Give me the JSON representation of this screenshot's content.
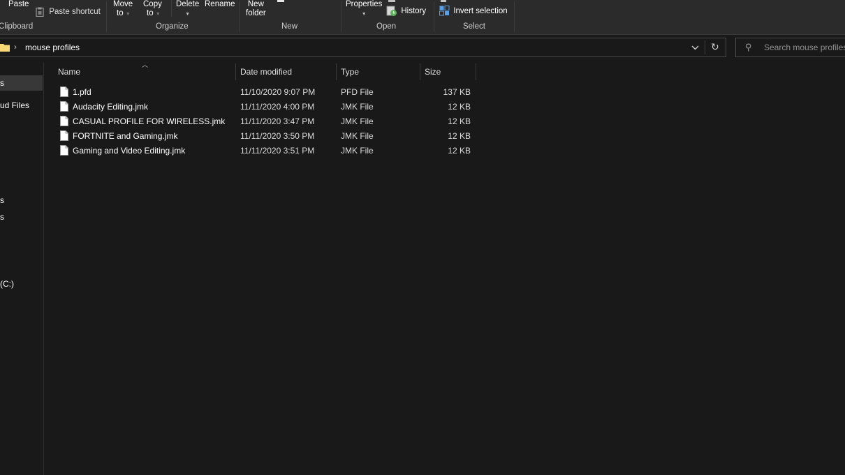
{
  "ribbon": {
    "clipboard": {
      "paste_label": "Paste",
      "paste_shortcut_label": "Paste shortcut",
      "group_label": "Clipboard"
    },
    "organize": {
      "move_to_line1": "Move",
      "move_to_line2": "to",
      "copy_to_line1": "Copy",
      "copy_to_line2": "to",
      "delete_label": "Delete",
      "rename_label": "Rename",
      "group_label": "Organize"
    },
    "new": {
      "new_folder_line1": "New",
      "new_folder_line2": "folder",
      "group_label": "New"
    },
    "open": {
      "properties_label": "Properties",
      "history_label": "History",
      "group_label": "Open"
    },
    "select": {
      "invert_selection_label": "Invert selection",
      "group_label": "Select"
    }
  },
  "address": {
    "current_folder": "mouse profiles",
    "search_placeholder": "Search mouse profiles"
  },
  "nav": {
    "items": [
      {
        "label": "s"
      },
      {
        "label": "ud Files"
      },
      {
        "label": "s"
      },
      {
        "label": "s"
      },
      {
        "label": "(C:)"
      }
    ]
  },
  "columns": {
    "name": "Name",
    "date_modified": "Date modified",
    "type": "Type",
    "size": "Size"
  },
  "files": [
    {
      "name": "1.pfd",
      "date": "11/10/2020 9:07 PM",
      "type": "PFD File",
      "size": "137 KB"
    },
    {
      "name": "Audacity Editing.jmk",
      "date": "11/11/2020 4:00 PM",
      "type": "JMK File",
      "size": "12 KB"
    },
    {
      "name": "CASUAL PROFILE FOR WIRELESS.jmk",
      "date": "11/11/2020 3:47 PM",
      "type": "JMK File",
      "size": "12 KB"
    },
    {
      "name": "FORTNITE and Gaming.jmk",
      "date": "11/11/2020 3:50 PM",
      "type": "JMK File",
      "size": "12 KB"
    },
    {
      "name": "Gaming and Video Editing.jmk",
      "date": "11/11/2020 3:51 PM",
      "type": "JMK File",
      "size": "12 KB"
    }
  ],
  "colors": {
    "background": "#191919",
    "ribbon": "#2b2b2b",
    "selected_nav": "#383838",
    "folder_yellow": "#f8d775"
  }
}
